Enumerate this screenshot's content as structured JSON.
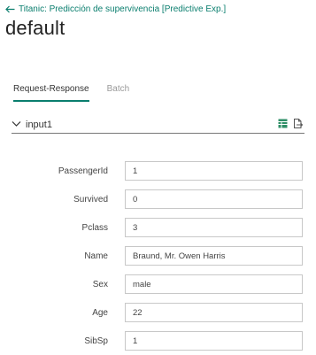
{
  "back_link": {
    "label": "Titanic: Predicción de supervivencia [Predictive Exp.]"
  },
  "page_title": "default",
  "tabs": [
    {
      "label": "Request-Response",
      "active": true
    },
    {
      "label": "Batch",
      "active": false
    }
  ],
  "section": {
    "title": "input1",
    "expanded": true
  },
  "icons": [
    "table-view-icon",
    "export-document-icon"
  ],
  "fields": [
    {
      "label": "PassengerId",
      "value": "1"
    },
    {
      "label": "Survived",
      "value": "0"
    },
    {
      "label": "Pclass",
      "value": "3"
    },
    {
      "label": "Name",
      "value": "Braund, Mr. Owen Harris"
    },
    {
      "label": "Sex",
      "value": "male"
    },
    {
      "label": "Age",
      "value": "22"
    },
    {
      "label": "SibSp",
      "value": "1"
    }
  ],
  "colors": {
    "accent": "#0a7e6e",
    "border": "#c8c8c8",
    "divider": "#777777"
  }
}
